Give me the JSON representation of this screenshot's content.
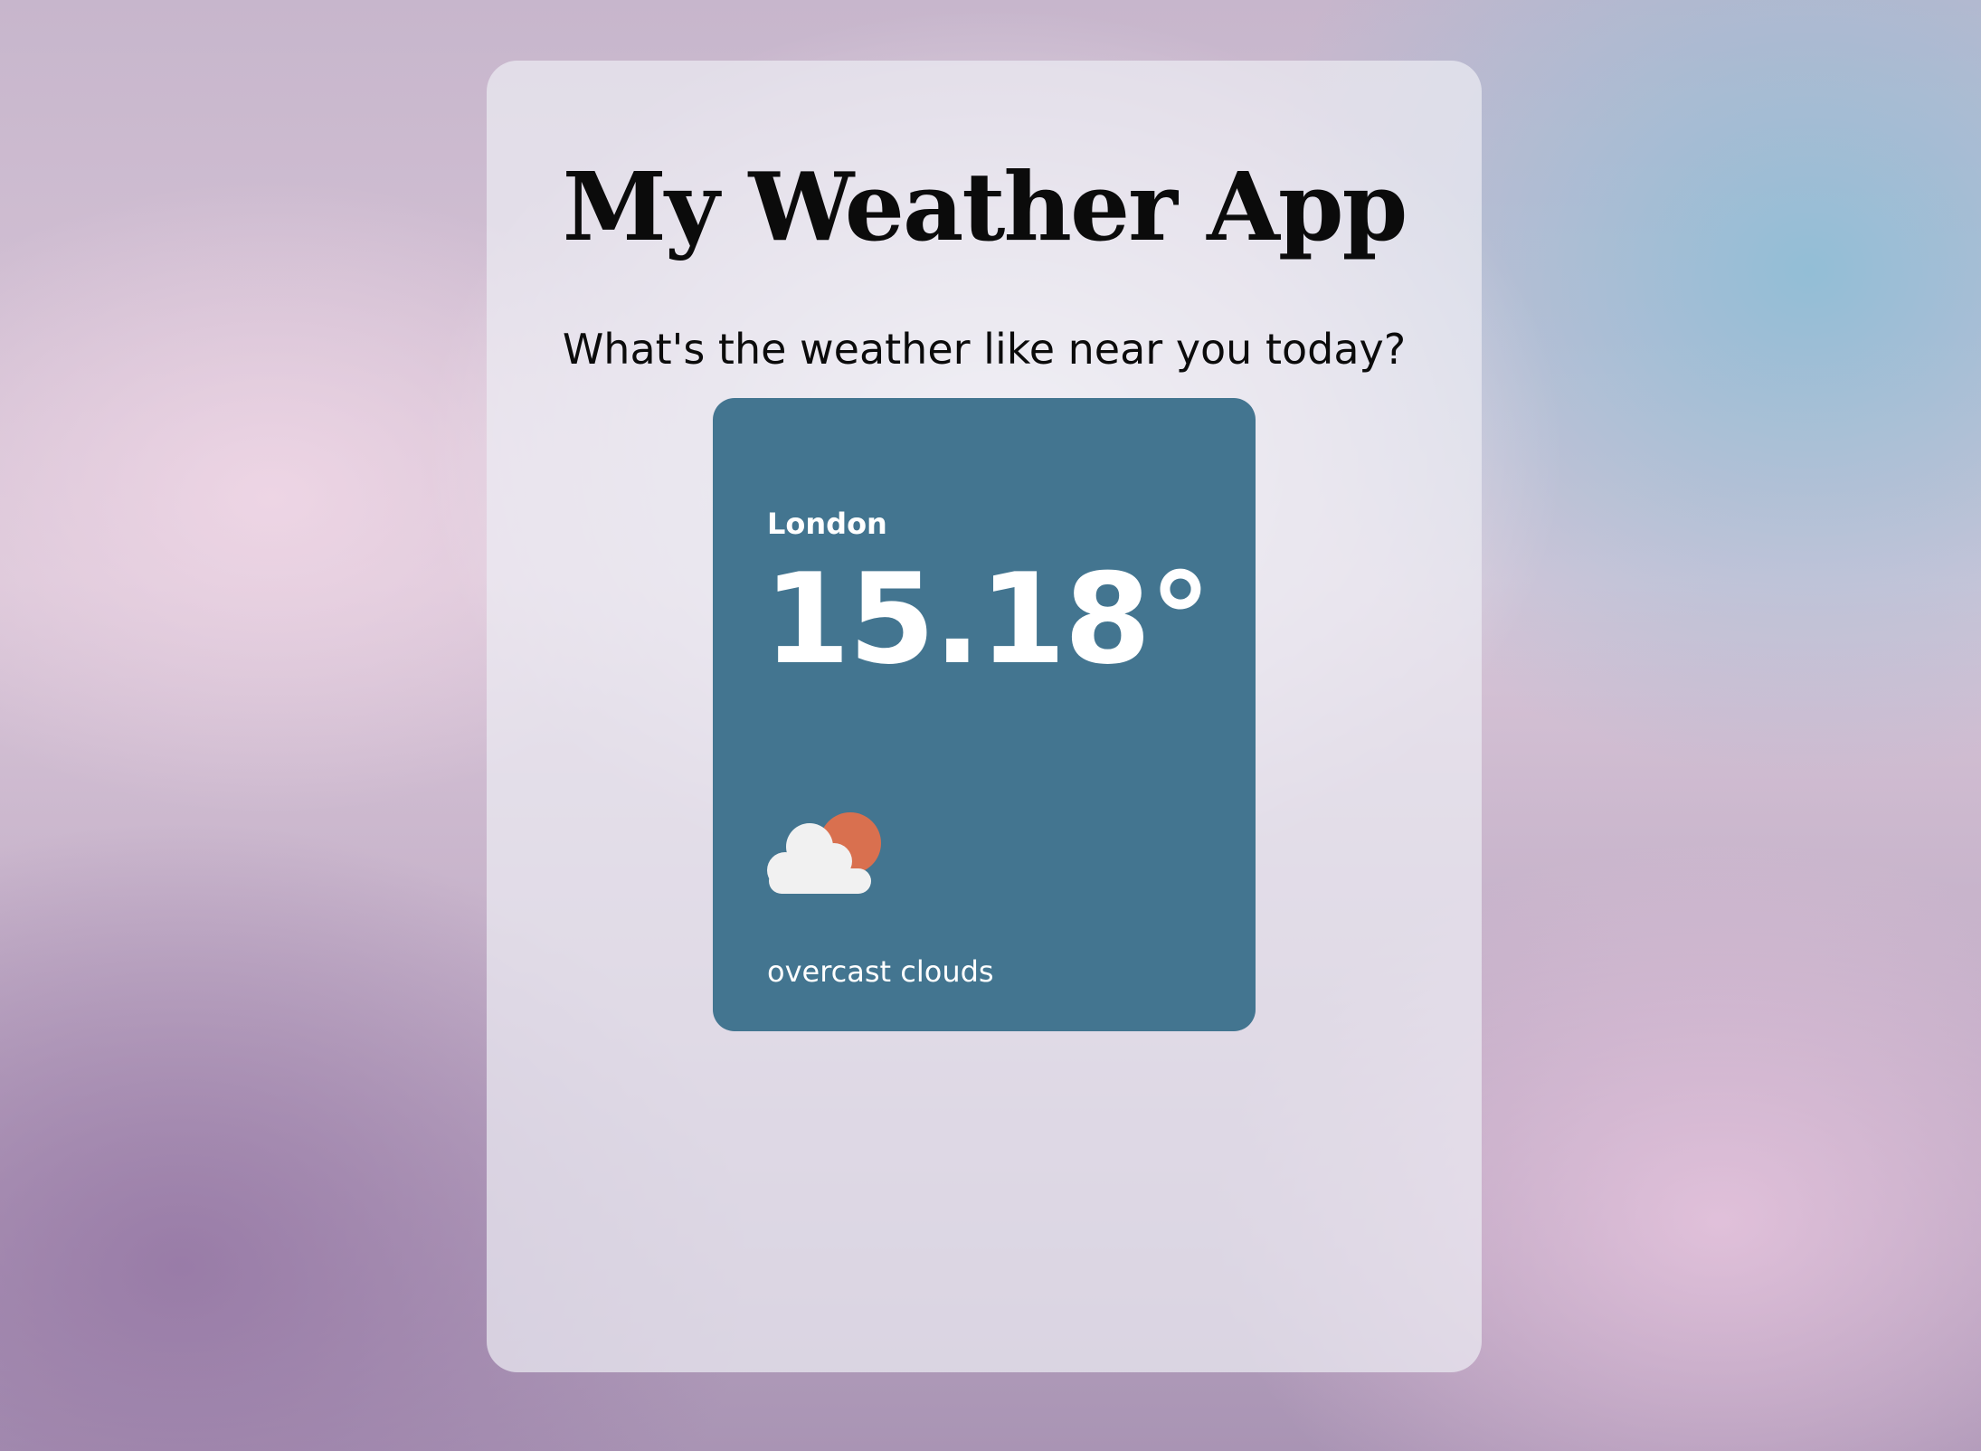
{
  "app": {
    "title": "My Weather App",
    "subtitle": "What's the weather like near you today?"
  },
  "weather_card": {
    "city": "London",
    "temperature": "15.18°",
    "description": "overcast clouds",
    "icon": "cloud-with-sun-icon"
  },
  "colors": {
    "card_background": "#437590",
    "sun": "#d9704f",
    "cloud": "#f1f1f1",
    "panel_background": "rgba(236,236,242,0.72)"
  }
}
